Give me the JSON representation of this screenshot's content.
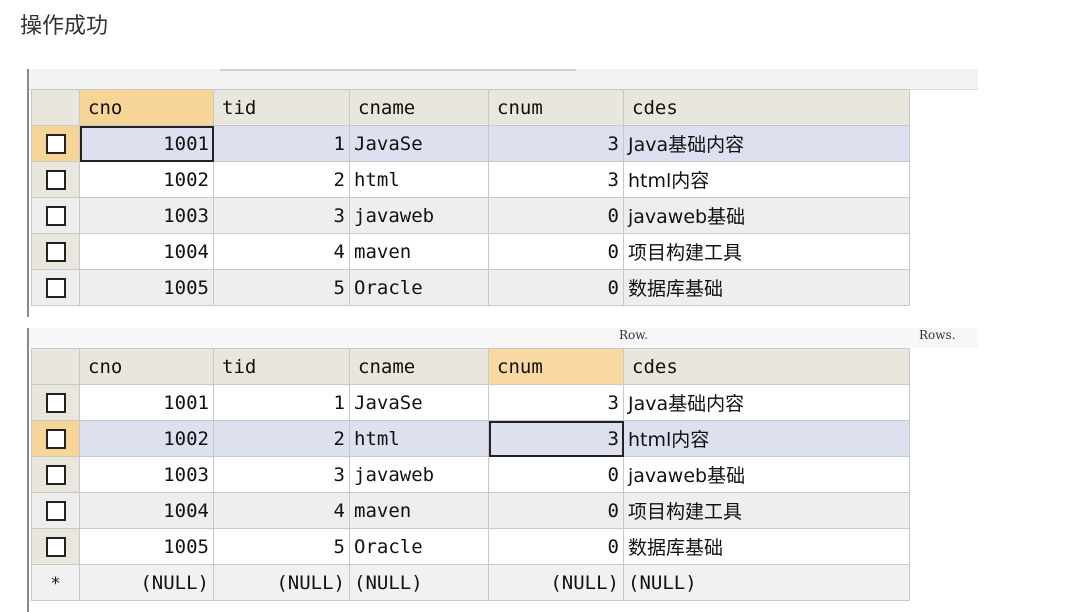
{
  "page_title": "操作成功",
  "columns": [
    "cno",
    "tid",
    "cname",
    "cnum",
    "cdes"
  ],
  "rows": [
    {
      "cno": "1001",
      "tid": "1",
      "cname": "JavaSe",
      "cnum": "3",
      "cdes": "Java基础内容"
    },
    {
      "cno": "1002",
      "tid": "2",
      "cname": "html",
      "cnum": "3",
      "cdes": "html内容"
    },
    {
      "cno": "1003",
      "tid": "3",
      "cname": "javaweb",
      "cnum": "0",
      "cdes": "javaweb基础"
    },
    {
      "cno": "1004",
      "tid": "4",
      "cname": "maven",
      "cnum": "0",
      "cdes": "项目构建工具"
    },
    {
      "cno": "1005",
      "tid": "5",
      "cname": "Oracle",
      "cnum": "0",
      "cdes": "数据库基础"
    }
  ],
  "null_row": {
    "marker": "*",
    "cno": "(NULL)",
    "tid": "(NULL)",
    "cname": "(NULL)",
    "cnum": "(NULL)",
    "cdes": "(NULL)"
  },
  "status": {
    "left": "Row.",
    "right": "Rows."
  },
  "colors": {
    "header_bg": "#e9e6de",
    "header_active_bg": "#f9d9a1",
    "row_selected_bg": "#dde0ef"
  }
}
